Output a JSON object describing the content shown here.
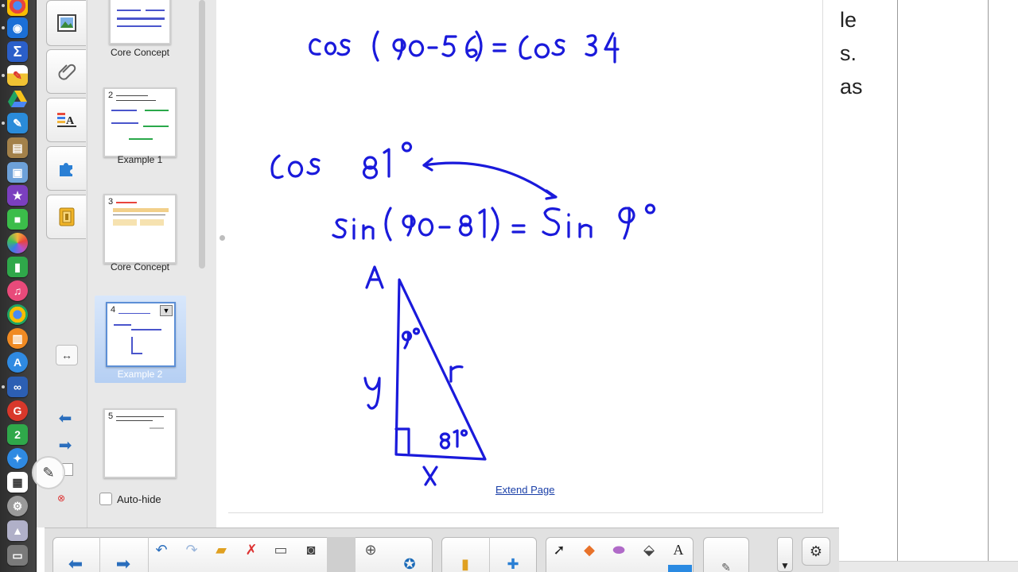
{
  "colors": {
    "ink_blue": "#1a1adb",
    "selection_blue": "#b5cff3",
    "link_blue": "#1a3fa8"
  },
  "sorter": {
    "pages": [
      {
        "num": "",
        "label": "Core Concept"
      },
      {
        "num": "2",
        "label": "Example 1"
      },
      {
        "num": "3",
        "label": "Core Concept"
      },
      {
        "num": "4",
        "label": "Example 2"
      },
      {
        "num": "5",
        "label": ""
      }
    ],
    "auto_hide_label": "Auto-hide"
  },
  "canvas": {
    "extend_page_label": "Extend Page",
    "ink_lines": [
      "cos(90-56) = cos 34",
      "cos 81°",
      "sin(90-81) = Sin 9°"
    ],
    "triangle": {
      "vertex_label": "A",
      "side_left": "y",
      "side_hyp": "r",
      "side_bottom": "x",
      "top_angle": "9°",
      "bottom_angle": "81°"
    }
  },
  "background_window": {
    "text_fragments": [
      "le",
      "s.",
      "as"
    ]
  },
  "side_tabs": [
    {
      "icon": "image-icon"
    },
    {
      "icon": "paperclip-icon"
    },
    {
      "icon": "properties-icon"
    },
    {
      "icon": "puzzle-icon"
    },
    {
      "icon": "gallery-icon"
    }
  ],
  "dock": {
    "icons": [
      "chrome-icon",
      "safari-icon",
      "sigma-icon",
      "calendar-icon",
      "drive-icon",
      "notes-icon",
      "contacts-icon",
      "preview-icon",
      "imovie-icon",
      "messages-icon",
      "photos-icon",
      "numbers-icon",
      "itunes-icon",
      "chrome-alt-icon",
      "ibooks-icon",
      "appstore-icon",
      "loop-icon",
      "google-icon",
      "two-icon",
      "safari-alt-icon",
      "grid-icon",
      "camera-icon",
      "launch-icon",
      "trash-icon"
    ]
  }
}
